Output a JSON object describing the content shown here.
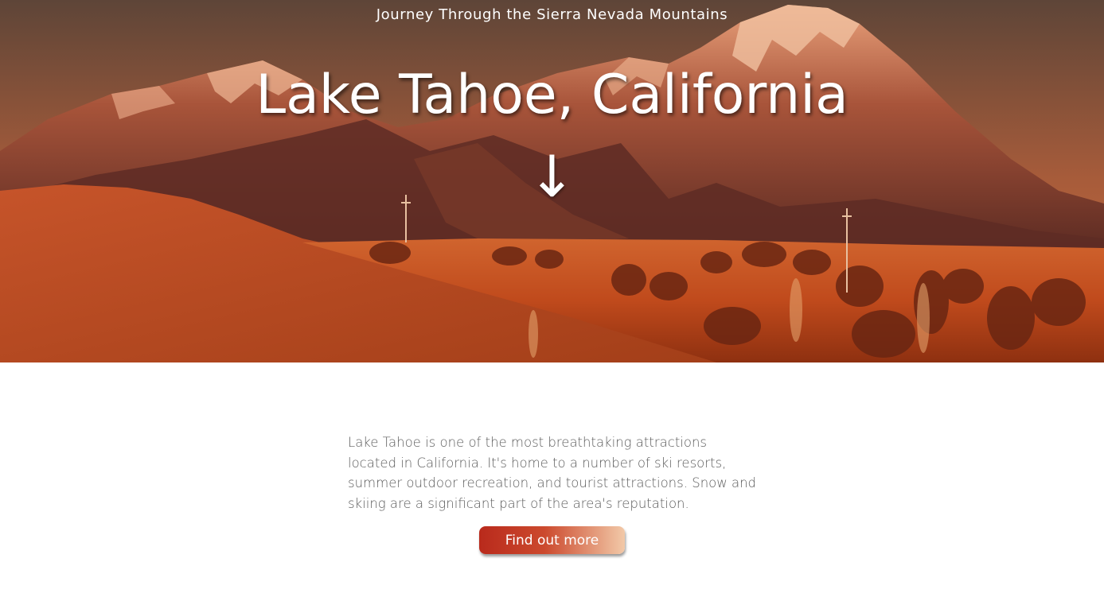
{
  "hero": {
    "subtitle": "Journey Through the Sierra Nevada Mountains",
    "title": "Lake Tahoe, California",
    "scroll_arrow": "↓"
  },
  "main": {
    "intro": "Lake Tahoe is one of the most breathtaking attractions located in California. It's home to a number of ski resorts, summer outdoor recreation, and tourist attractions. Snow and skiing are a significant part of the area's reputation.",
    "cta_label": "Find out more"
  },
  "colors": {
    "cta_start": "#b92a1c",
    "cta_end": "#f2c9a8",
    "body_text": "#5c5c5c",
    "hero_text": "#ffffff"
  },
  "icons": {
    "scroll": "arrow-down-icon"
  }
}
